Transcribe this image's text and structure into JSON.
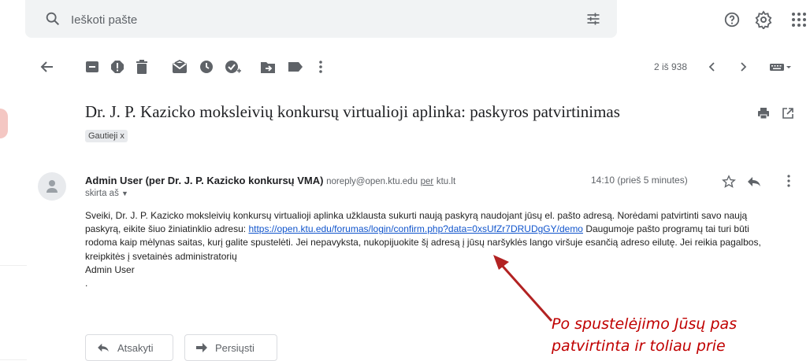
{
  "search": {
    "placeholder": "Ieškoti pašte"
  },
  "toolbar": {
    "pagination": "2 iš 938"
  },
  "email": {
    "subject": "Dr. J. P. Kazicko moksleivių konkursų virtualioji aplinka: paskyros patvirtinimas",
    "label": "Gautieji",
    "label_remove": "x",
    "sender_name": "Admin User (per Dr. J. P. Kazicko konkursų VMA)",
    "sender_email": "noreply@open.ktu.edu",
    "via_label": "per",
    "via_domain": "ktu.lt",
    "recipient": "skirta aš",
    "time": "14:10 (prieš 5 minutes)",
    "body_intro": "Sveiki, Dr. J. P. Kazicko moksleivių konkursų virtualioji aplinka užklausta sukurti naują paskyrą naudojant jūsų el. pašto adresą. Norėdami patvirtinti savo naują paskyrą, eikite šiuo žiniatinklio adresu: ",
    "body_link": "https://open.ktu.edu/forumas/login/confirm.php?data=0xsUfZr7DRUDgGY/demo",
    "body_rest": " Daugumoje pašto programų tai turi būti rodoma kaip mėlynas saitas, kurį galite spustelėti. Jei nepavyksta, nukopijuokite šį adresą į jūsų naršyklės lango viršuje esančią adreso eilutę. Jei reikia pagalbos, kreipkitės į svetainės administratorių",
    "signature": "Admin User",
    "dot": "."
  },
  "actions": {
    "reply": "Atsakyti",
    "forward": "Persiųsti"
  },
  "annotation": {
    "line1": "Po spustelėjimo Jūsų pas",
    "line2": "patvirtinta ir toliau prie"
  },
  "colors": {
    "link": "#1155cc",
    "annotation": "#c00000",
    "arrow": "#b22222"
  }
}
